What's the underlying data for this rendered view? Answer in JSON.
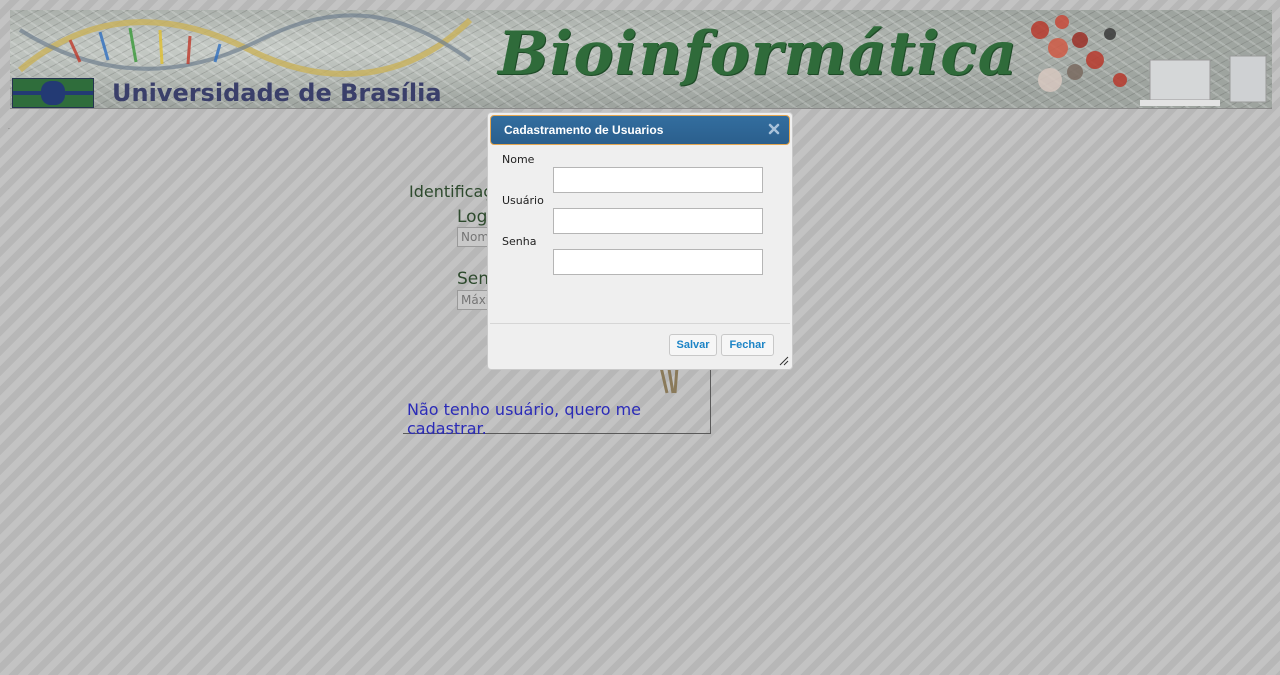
{
  "banner": {
    "title": "Bioinformática",
    "university": "Universidade de Brasília",
    "logo_icon": "unb-logo-icon"
  },
  "login": {
    "heading": "Identificação",
    "login_label": "Login",
    "login_placeholder": "Nome",
    "password_label": "Senha",
    "password_placeholder": "Máximo",
    "register_link": "Não tenho usuário, quero me cadastrar.",
    "key_icon": "key-icon"
  },
  "dialog": {
    "title": "Cadastramento de Usuarios",
    "close_icon": "close-icon",
    "fields": [
      {
        "label": "Nome",
        "value": ""
      },
      {
        "label": "Usuário",
        "value": ""
      },
      {
        "label": "Senha",
        "value": ""
      }
    ],
    "save_label": "Salvar",
    "close_label": "Fechar",
    "resize_icon": "resize-grip-icon"
  },
  "colors": {
    "titlebar": "#2b5f8d",
    "button_text": "#1c84c6",
    "link": "#2b2bb8",
    "banner_title": "#2f6b3a",
    "university": "#3a3f6a"
  }
}
